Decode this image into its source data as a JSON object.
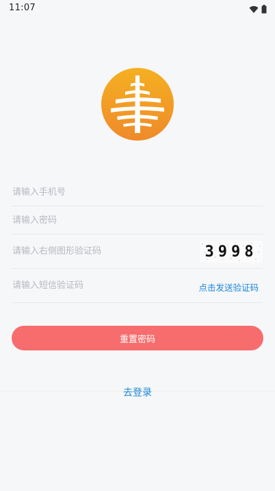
{
  "status_bar": {
    "time": "11:07",
    "icons": [
      "wifi-icon",
      "battery-icon"
    ]
  },
  "logo": {
    "icon": "tree-logo-icon",
    "colors": [
      "#f5b021",
      "#ef8a2a"
    ]
  },
  "form": {
    "phone_placeholder": "请输入手机号",
    "password_placeholder": "请输入密码",
    "captcha_placeholder": "请输入右侧图形验证码",
    "captcha_text": "3998",
    "sms_placeholder": "请输入短信验证码",
    "send_sms_label": "点击发送验证码"
  },
  "actions": {
    "reset_password_label": "重置密码",
    "login_link_label": "去登录"
  },
  "colors": {
    "accent_button": "#f76d6e",
    "link": "#1e87d6",
    "background": "#f6f7f9"
  }
}
